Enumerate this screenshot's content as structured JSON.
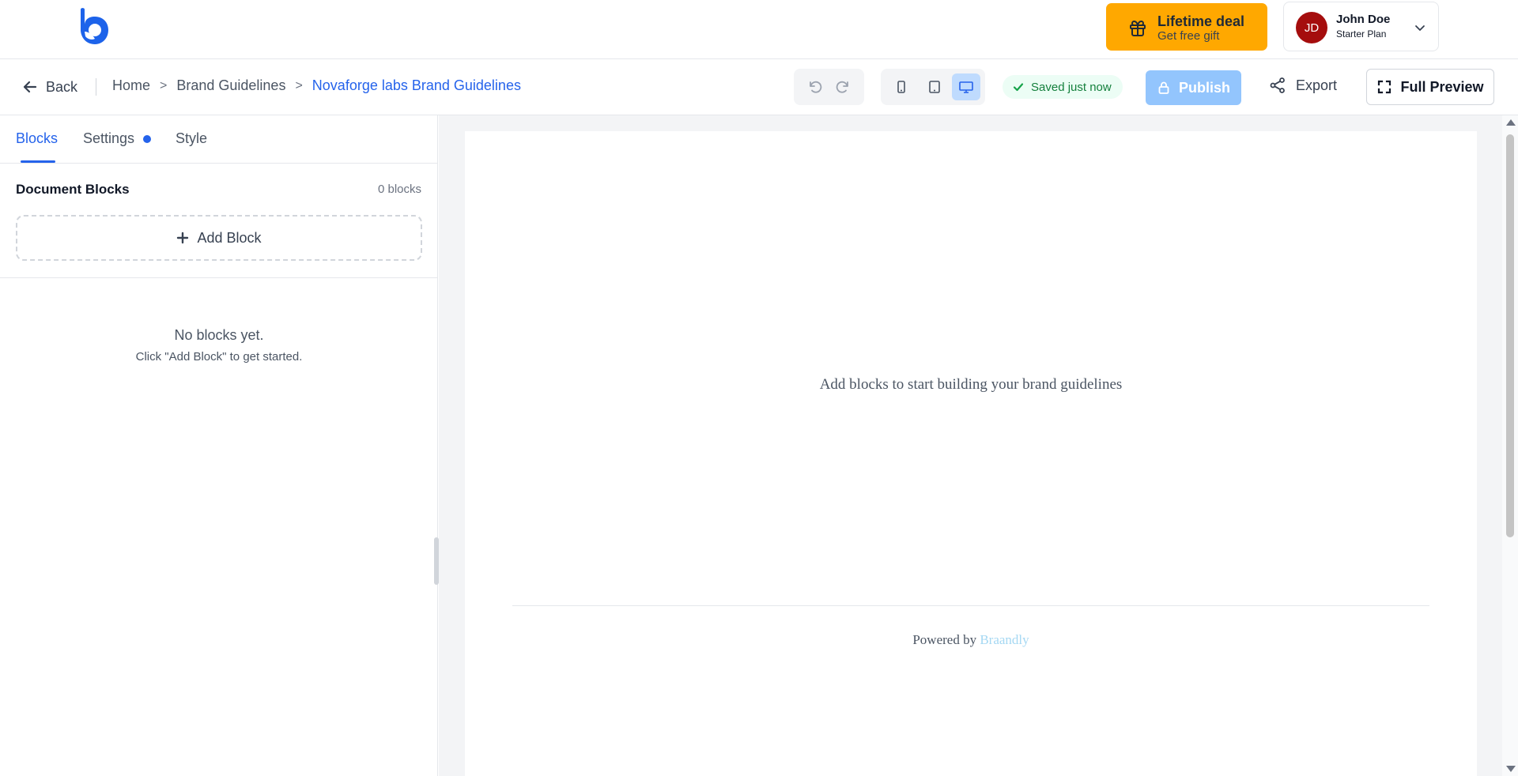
{
  "brand": {
    "accent": "#2563eb",
    "logo_icon": "braandly-logo-icon"
  },
  "promo": {
    "title": "Lifetime deal",
    "subtitle": "Get free gift",
    "color": "#ffa800"
  },
  "user": {
    "initials": "JD",
    "name": "John Doe",
    "plan": "Starter Plan",
    "avatar_color": "#a50d0d"
  },
  "nav": {
    "back_label": "Back",
    "breadcrumb": [
      "Home",
      "Brand Guidelines",
      "Novaforge labs Brand Guidelines"
    ],
    "separator": ">"
  },
  "toolbar": {
    "undo_icon": "undo-icon",
    "redo_icon": "redo-icon",
    "devices": [
      "mobile",
      "tablet",
      "desktop"
    ],
    "active_device": "desktop",
    "saved_status": "Saved just now",
    "publish_label": "Publish",
    "export_label": "Export",
    "full_preview_label": "Full Preview"
  },
  "sidebar": {
    "tabs": [
      {
        "label": "Blocks",
        "active": true
      },
      {
        "label": "Settings",
        "active": false,
        "has_indicator": true
      },
      {
        "label": "Style",
        "active": false
      }
    ],
    "section_title": "Document Blocks",
    "block_count": "0 blocks",
    "add_block_label": "Add Block",
    "empty_title": "No blocks yet.",
    "empty_hint": "Click \"Add Block\" to get started."
  },
  "canvas": {
    "placeholder": "Add blocks to start building your brand guidelines",
    "powered_by": "Powered by",
    "powered_brand": "Braandly"
  }
}
